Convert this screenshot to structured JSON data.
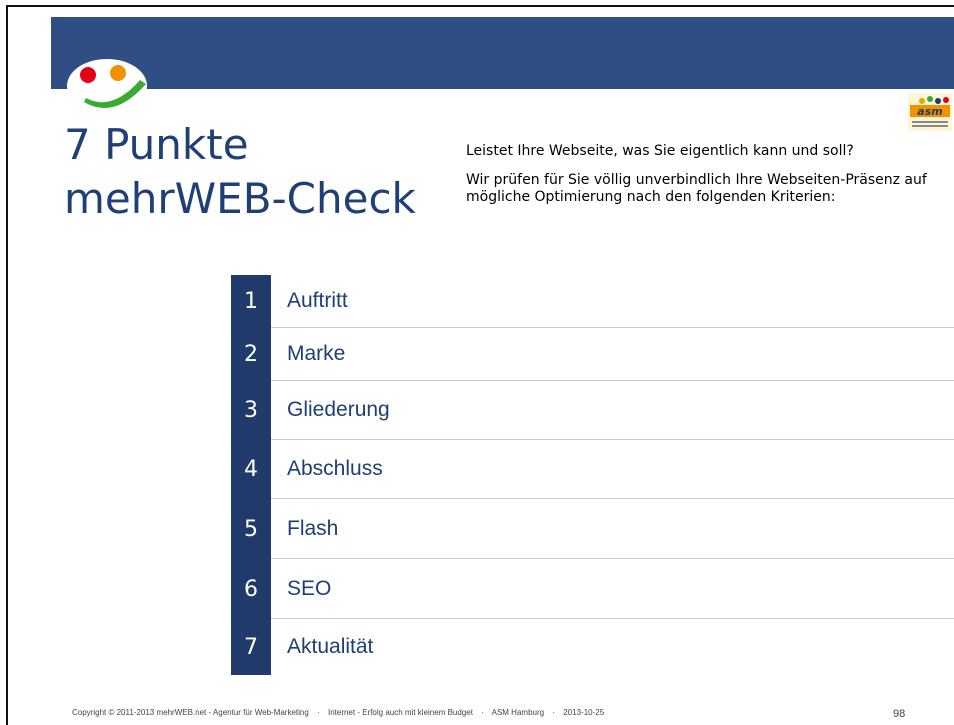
{
  "slide": {
    "title_line1": "7 Punkte",
    "title_line2": "mehrWEB-Check",
    "intro_lead": "Leistet Ihre Webseite, was Sie eigentlich kann und soll?",
    "intro_text": "Wir prüfen für Sie völlig unverbindlich Ihre Webseiten-Präsenz auf mögliche Optimierung nach den folgenden Kriterien:",
    "asm_logo_text": "asm",
    "criteria": [
      {
        "num": "1",
        "label": "Auftritt"
      },
      {
        "num": "2",
        "label": "Marke"
      },
      {
        "num": "3",
        "label": "Gliederung"
      },
      {
        "num": "4",
        "label": "Abschluss"
      },
      {
        "num": "5",
        "label": "Flash"
      },
      {
        "num": "6",
        "label": "SEO"
      },
      {
        "num": "7",
        "label": "Aktualität"
      }
    ]
  },
  "footer": {
    "copyright": "Copyright © 2011-2013  mehrWEB.net - Agentur für Web-Marketing",
    "part2": "Internet - Erfolg auch mit kleinem Budget",
    "part3": "ASM Hamburg",
    "date": "2013-10-25",
    "separator": "·",
    "page_number": "98"
  },
  "colors": {
    "band": "#2e4e84",
    "number_box": "#1f3a6b",
    "title": "#1f3f77",
    "logo_red": "#e3001b",
    "logo_orange": "#f39200",
    "logo_green": "#3aaa35"
  }
}
